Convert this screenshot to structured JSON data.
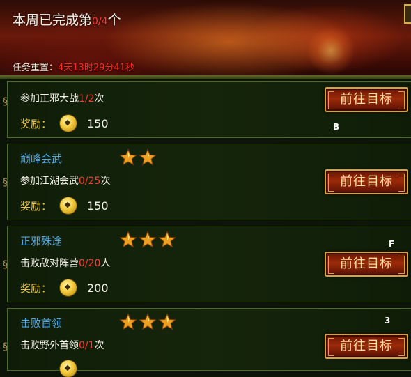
{
  "header": {
    "title_prefix": "本周已完成第",
    "completed": "0",
    "sep": "/",
    "total": "4",
    "title_suffix": "个",
    "reset_label": "任务重置：",
    "reset_time": "4天13时29分41秒"
  },
  "quests": [
    {
      "name": "",
      "stars": 0,
      "req_prefix": "参加正邪大战",
      "progress": "1/2",
      "req_suffix": "次",
      "reward_label": "奖励：",
      "reward_value": "150",
      "button": "前往目标",
      "marker": "B"
    },
    {
      "name": "巅峰会武",
      "stars": 2,
      "req_prefix": "参加江湖会武",
      "progress": "0/25",
      "req_suffix": "次",
      "reward_label": "奖励：",
      "reward_value": "150",
      "button": "前往目标",
      "marker": ""
    },
    {
      "name": "正邪殊途",
      "stars": 3,
      "req_prefix": "击败敌对阵营",
      "progress": "0/20",
      "req_suffix": "人",
      "reward_label": "奖励：",
      "reward_value": "200",
      "button": "前往目标",
      "marker": "F"
    },
    {
      "name": "击败首领",
      "stars": 3,
      "req_prefix": "击败野外首领",
      "progress": "0/1",
      "req_suffix": "次",
      "reward_label": "",
      "reward_value": "",
      "button": "前往目标",
      "marker": "3"
    }
  ],
  "icons": {
    "star": "star-icon",
    "coin": "coin-icon"
  },
  "colors": {
    "highlight_red": "#ff3b30",
    "quest_name_blue": "#4fa8e8",
    "reward_gold": "#e8c53c",
    "button_border": "#d6a43c"
  }
}
